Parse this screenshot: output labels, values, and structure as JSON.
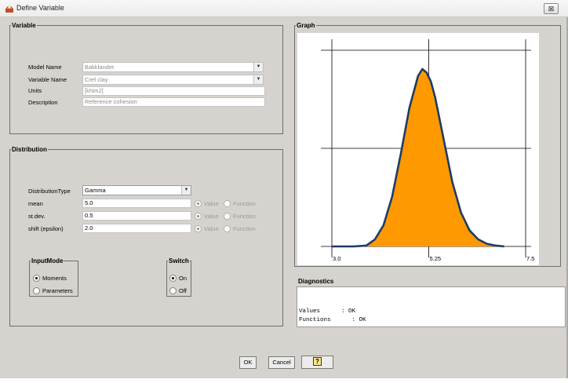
{
  "window": {
    "title": "Define Variable",
    "close_glyph": "⊠"
  },
  "variable": {
    "legend": "Variable",
    "model_name": {
      "label": "Model Name",
      "value": "Bakklandet"
    },
    "variable_name": {
      "label": "Variable Name",
      "value": "Cref clay"
    },
    "units": {
      "label": "Units",
      "value": "[kNm2]"
    },
    "description": {
      "label": "Description",
      "value": "Reference cohesion"
    }
  },
  "distribution": {
    "legend": "Distribution",
    "type": {
      "label": "DistributionType",
      "value": "Gamma"
    },
    "params": [
      {
        "label": "mean",
        "value": "5.0",
        "value_option": "Value",
        "function_option": "Function",
        "selected": "Value"
      },
      {
        "label": "st.dev.",
        "value": "0.5",
        "value_option": "Value",
        "function_option": "Function",
        "selected": "Value"
      },
      {
        "label": "shift (epsilon)",
        "value": "2.0",
        "value_option": "Value",
        "function_option": "Function",
        "selected": "Value"
      }
    ],
    "input_mode": {
      "legend": "InputMode",
      "options": [
        "Moments",
        "Parameters"
      ],
      "selected": "Moments"
    },
    "switch": {
      "legend": "Switch",
      "options": [
        "On",
        "Off"
      ],
      "selected": "On"
    }
  },
  "graph": {
    "legend": "Graph",
    "fill_color": "#ff9900",
    "outline_color": "#1f3a66"
  },
  "chart_data": {
    "type": "area",
    "title": "",
    "xlabel": "",
    "ylabel": "",
    "xlim": [
      3.0,
      7.5
    ],
    "x_tick_labels": [
      "3.0",
      "5.25",
      "7.5"
    ],
    "series": [
      {
        "values_description": "",
        "x": [
          3.0,
          3.5,
          3.8,
          4.0,
          4.2,
          4.4,
          4.6,
          4.8,
          5.0,
          5.1,
          5.2,
          5.3,
          5.4,
          5.6,
          5.8,
          6.0,
          6.2,
          6.4,
          6.6,
          6.8,
          7.0
        ],
        "y": [
          0.0,
          0.0,
          0.005,
          0.04,
          0.12,
          0.28,
          0.52,
          0.78,
          0.96,
          1.0,
          0.98,
          0.93,
          0.84,
          0.6,
          0.36,
          0.19,
          0.09,
          0.04,
          0.015,
          0.005,
          0.0
        ]
      }
    ]
  },
  "diagnostics": {
    "title": "Diagnostics",
    "lines": [
      "Values      : OK",
      "Functions      : OK"
    ]
  },
  "buttons": {
    "ok": "OK",
    "cancel": "Cancel",
    "help_glyph": "?"
  }
}
